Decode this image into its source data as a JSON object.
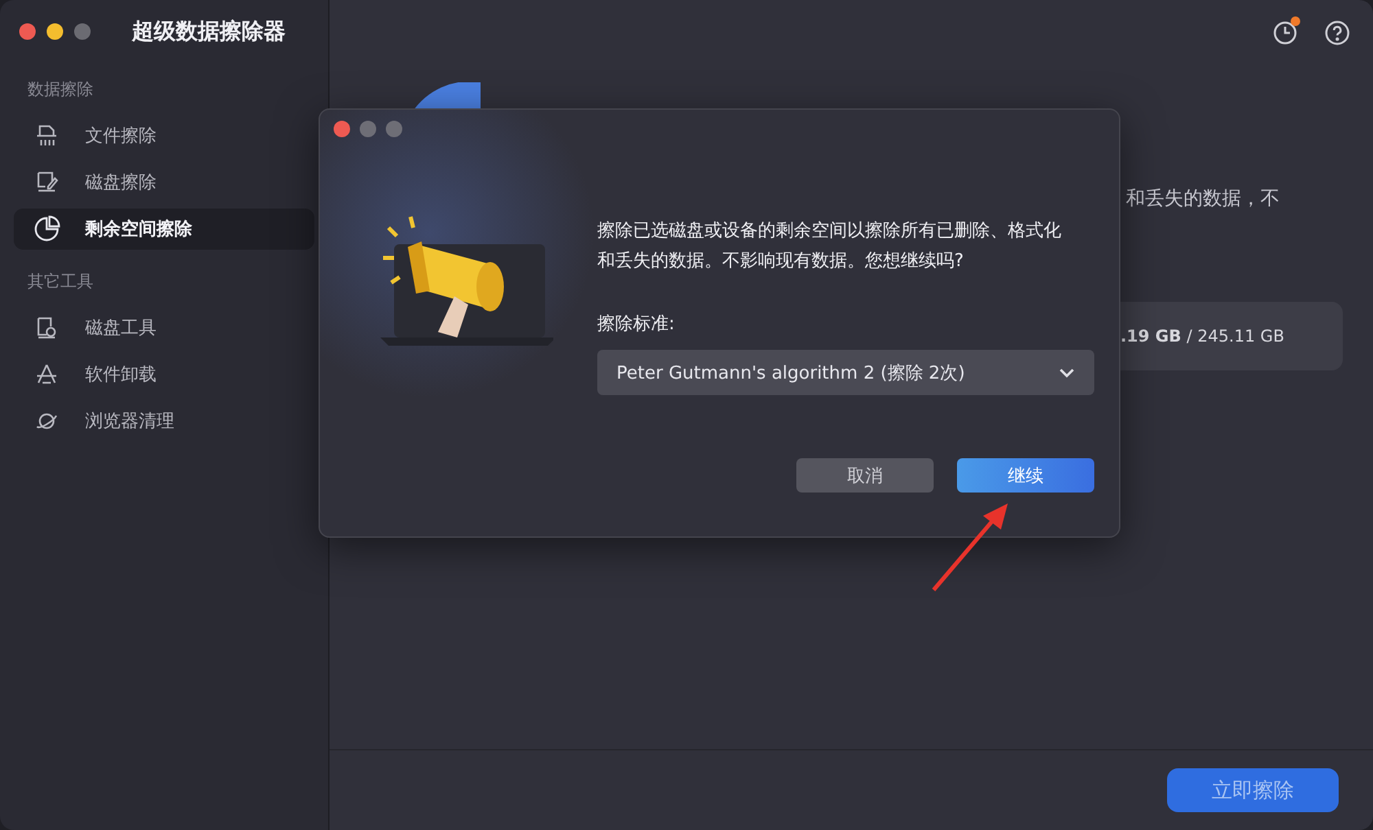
{
  "window": {
    "title": "超级数据擦除器"
  },
  "toolbar": {
    "history_badge": true
  },
  "sidebar": {
    "sections": [
      {
        "heading": "数据擦除",
        "items": [
          {
            "label": "文件擦除",
            "kind": "shredder",
            "selected": false
          },
          {
            "label": "磁盘擦除",
            "kind": "disk",
            "selected": false
          },
          {
            "label": "剩余空间擦除",
            "kind": "pie",
            "selected": true
          }
        ]
      },
      {
        "heading": "其它工具",
        "items": [
          {
            "label": "磁盘工具",
            "kind": "tool",
            "selected": false
          },
          {
            "label": "软件卸载",
            "kind": "apps",
            "selected": false
          },
          {
            "label": "浏览器清理",
            "kind": "planet",
            "selected": false
          }
        ]
      }
    ]
  },
  "main": {
    "description_fragment": "和丢失的数据，不",
    "storage": "**.19 GB** / 245.11 GB",
    "erase_button": "立即擦除"
  },
  "dialog": {
    "message": "擦除已选磁盘或设备的剩余空间以擦除所有已删除、格式化和丢失的数据。不影响现有数据。您想继续吗?",
    "standard_label": "擦除标准:",
    "standard_value": "Peter Gutmann's algorithm 2 (擦除 2次)",
    "buttons": [
      {
        "label": "取消",
        "kind": "secondary"
      },
      {
        "label": "继续",
        "kind": "primary"
      }
    ]
  }
}
